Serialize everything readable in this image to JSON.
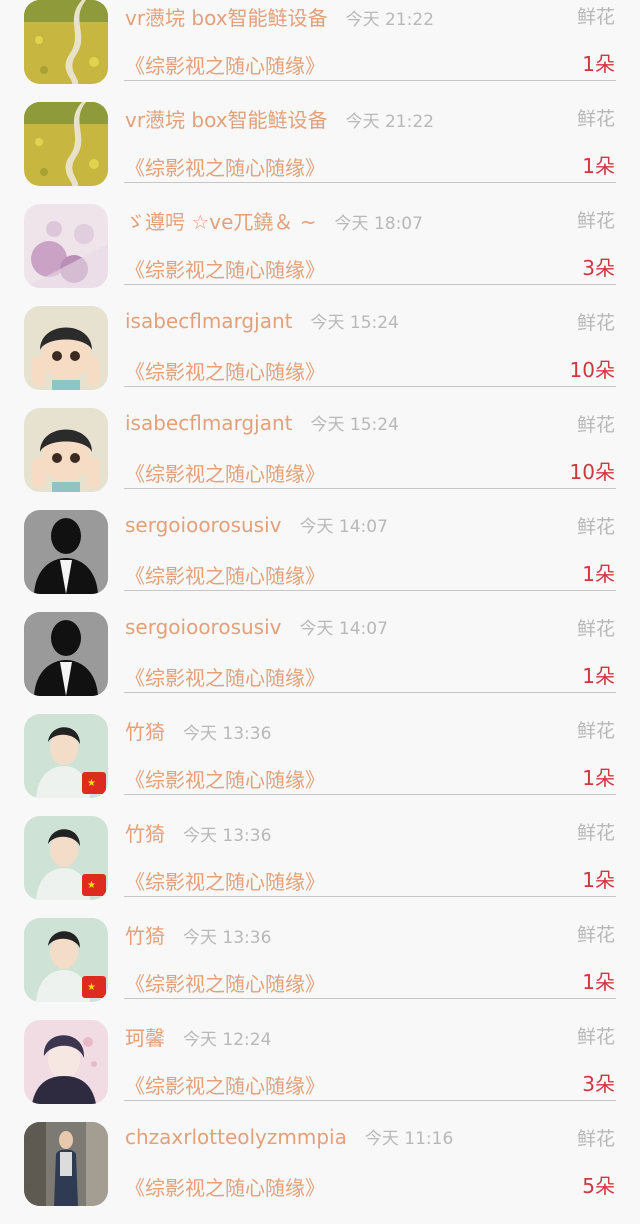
{
  "gift_list": {
    "items": [
      {
        "user": "vr懑垸 box智能鲢设备",
        "time": "今天 21:22",
        "gift_type": "鲜花",
        "program": "《综影视之随心随缘》",
        "count": "1朵",
        "avatar": "field-path"
      },
      {
        "user": "vr懑垸 box智能鲢设备",
        "time": "今天 21:22",
        "gift_type": "鲜花",
        "program": "《综影视之随心随缘》",
        "count": "1朵",
        "avatar": "field-path"
      },
      {
        "user": "ゞ遵呺 ☆ve兀鐃＆ ~",
        "time": "今天 18:07",
        "gift_type": "鲜花",
        "program": "《综影视之随心随缘》",
        "count": "3朵",
        "avatar": "flowers"
      },
      {
        "user": "isabecflmargjant",
        "time": "今天 15:24",
        "gift_type": "鲜花",
        "program": "《综影视之随心随缘》",
        "count": "10朵",
        "avatar": "anime-girl"
      },
      {
        "user": "isabecflmargjant",
        "time": "今天 15:24",
        "gift_type": "鲜花",
        "program": "《综影视之随心随缘》",
        "count": "10朵",
        "avatar": "anime-girl"
      },
      {
        "user": "sergoioorosusiv",
        "time": "今天 14:07",
        "gift_type": "鲜花",
        "program": "《综影视之随心随缘》",
        "count": "1朵",
        "avatar": "suit-figure"
      },
      {
        "user": "sergoioorosusiv",
        "time": "今天 14:07",
        "gift_type": "鲜花",
        "program": "《综影视之随心随缘》",
        "count": "1朵",
        "avatar": "suit-figure"
      },
      {
        "user": "竹猗",
        "time": "今天 13:36",
        "gift_type": "鲜花",
        "program": "《综影视之随心随缘》",
        "count": "1朵",
        "avatar": "portrait-flag"
      },
      {
        "user": "竹猗",
        "time": "今天 13:36",
        "gift_type": "鲜花",
        "program": "《综影视之随心随缘》",
        "count": "1朵",
        "avatar": "portrait-flag"
      },
      {
        "user": "竹猗",
        "time": "今天 13:36",
        "gift_type": "鲜花",
        "program": "《综影视之随心随缘》",
        "count": "1朵",
        "avatar": "portrait-flag"
      },
      {
        "user": "珂馨",
        "time": "今天 12:24",
        "gift_type": "鲜花",
        "program": "《综影视之随心随缘》",
        "count": "3朵",
        "avatar": "anime-boy-pink"
      },
      {
        "user": "chzaxrlotteolyzmmpia",
        "time": "今天 11:16",
        "gift_type": "鲜花",
        "program": "《综影视之随心随缘》",
        "count": "5朵",
        "avatar": "street-photo"
      }
    ]
  }
}
